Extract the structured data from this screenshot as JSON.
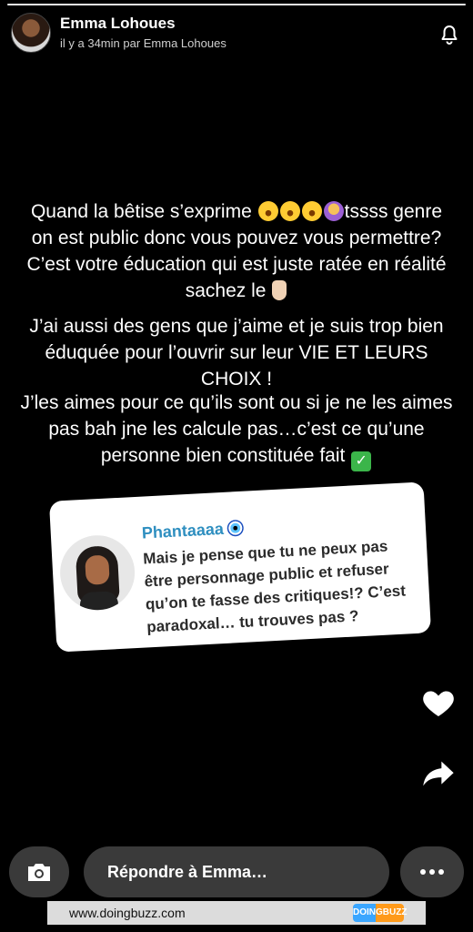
{
  "story": {
    "progress": 1.0
  },
  "header": {
    "user_name": "Emma Lohoues",
    "meta": "il y a 34min par Emma Lohoues",
    "avatar_icon": "profile-avatar",
    "bell_icon": "bell-icon"
  },
  "caption": {
    "p1_start": "Quand la bêtise s’exprime",
    "p1_after_emojis": "tssss",
    "p1_rest": "genre on est public donc vous pouvez vous permettre? C’est votre éducation qui est juste ratée en réalité sachez le",
    "p2": "J’ai aussi des gens que j’aime et je suis trop bien éduquée pour l’ouvrir sur leur VIE ET LEURS CHOIX !",
    "p3": "J’les aimes pour ce qu’ils sont ou si je ne les aimes pas bah jne les calcule pas…c’est ce qu’une personne bien constituée fait"
  },
  "question": {
    "name": "Phantaaaa",
    "text": "Mais je pense que tu ne peux pas être personnage public et refuser qu’on te fasse des critiques!? C’est paradoxal… tu trouves pas ?"
  },
  "bottom": {
    "reply_placeholder": "Répondre à Emma…"
  },
  "watermark": {
    "url": "www.doingbuzz.com",
    "logo": "DOINGBUZZ"
  },
  "colors": {
    "background": "#000000",
    "question_name": "#2f8fc0",
    "button_bg": "#3a3a3a"
  }
}
